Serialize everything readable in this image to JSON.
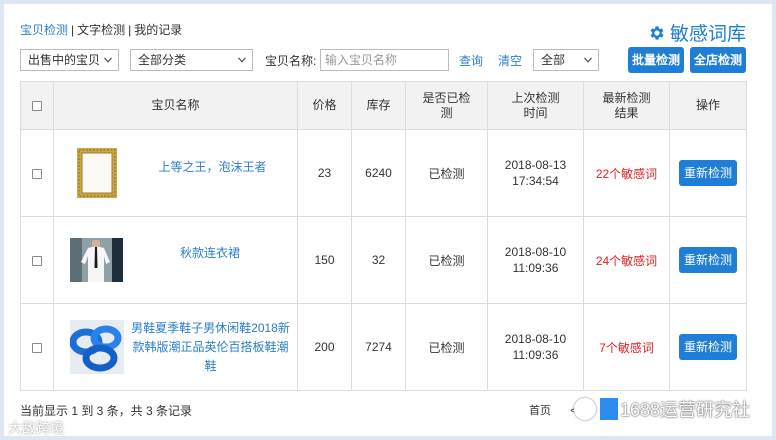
{
  "nav": {
    "item1": "宝贝检测",
    "item2": "文字检测",
    "item3": "我的记录",
    "sep": "|"
  },
  "brand": {
    "title": "敏感词库",
    "icon": "gear-icon"
  },
  "filters": {
    "status": "出售中的宝贝",
    "category": "全部分类",
    "name_label": "宝贝名称:",
    "name_placeholder": "输入宝贝名称",
    "query": "查询",
    "clear": "清空",
    "scope": "全部",
    "batch": "批量检测",
    "all_shop": "全店检测"
  },
  "table": {
    "headers": {
      "name": "宝贝名称",
      "price": "价格",
      "stock": "库存",
      "checked": "是否已检测",
      "last_time": "上次检测时间",
      "result": "最新检测结果",
      "op": "操作"
    },
    "rows": [
      {
        "name": "上等之王，泡沫王者",
        "price": "23",
        "stock": "6240",
        "checked": "已检测",
        "date": "2018-08-13",
        "time": "17:34:54",
        "result": "22个敏感词",
        "op": "重新检测",
        "thumb": "frame-thumbnail"
      },
      {
        "name": "秋款连衣裙",
        "price": "150",
        "stock": "32",
        "checked": "已检测",
        "date": "2018-08-10",
        "time": "11:09:36",
        "result": "24个敏感词",
        "op": "重新检测",
        "thumb": "shirt-thumbnail"
      },
      {
        "name": "男鞋夏季鞋子男休闲鞋2018新款韩版潮正品英伦百搭板鞋潮鞋",
        "price": "200",
        "stock": "7274",
        "checked": "已检测",
        "date": "2018-08-10",
        "time": "11:09:36",
        "result": "7个敏感词",
        "op": "重新检测",
        "thumb": "blue-rings-thumbnail"
      }
    ]
  },
  "footer": {
    "summary": "当前显示 1 到 3 条，共 3 条记录",
    "first_page": "首页",
    "prev": "<"
  },
  "watermark": {
    "right": "1688运营研究社",
    "left": "大敌跨境"
  },
  "colors": {
    "accent": "#1f7fd6",
    "link": "#2a7fc9",
    "danger": "#e02020",
    "header_bg": "#f2f2f2"
  }
}
